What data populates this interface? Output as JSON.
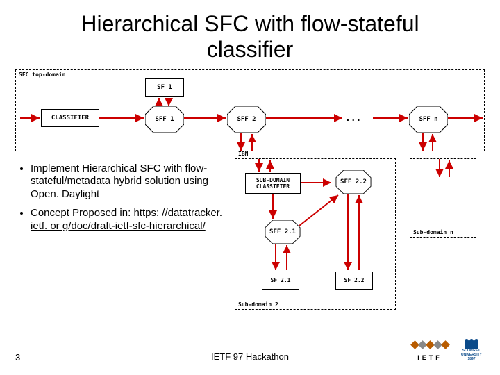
{
  "title": "Hierarchical SFC with flow-stateful classifier",
  "top_diagram": {
    "label": "SFC top-domain",
    "nodes": {
      "classifier": "CLASSIFIER",
      "sf1": "SF 1",
      "sff1": "SFF 1",
      "sff2": "SFF 2",
      "sffn": "SFF n",
      "dots": ". . ."
    }
  },
  "sub_ibn": {
    "label": "IBN",
    "nodes": {
      "sub_classifier": "SUB-DOMAIN\nCLASSIFIER",
      "sff22": "SFF 2.2",
      "sff21": "SFF 2.1",
      "sf21": "SF 2.1",
      "sf22": "SF 2.2"
    },
    "bottom_label": "Sub-domain 2"
  },
  "sub_n": {
    "label": "Sub-domain n"
  },
  "bullets": [
    "Implement Hierarchical SFC with flow-stateful/metadata hybrid solution using Open. Daylight",
    {
      "prefix": "Concept Proposed in: ",
      "link_text": "https: //datatracker. ietf. or g/doc/draft-ietf-sfc-hierarchical/"
    }
  ],
  "footer": {
    "page_number": "3",
    "text": "IETF 97 Hackathon",
    "ietf_label": "IETF",
    "ssu_line1": "SOONGSIL",
    "ssu_line2": "UNIVERSITY",
    "ssu_year": "1897"
  },
  "colors": {
    "arrow": "#cc0000"
  }
}
